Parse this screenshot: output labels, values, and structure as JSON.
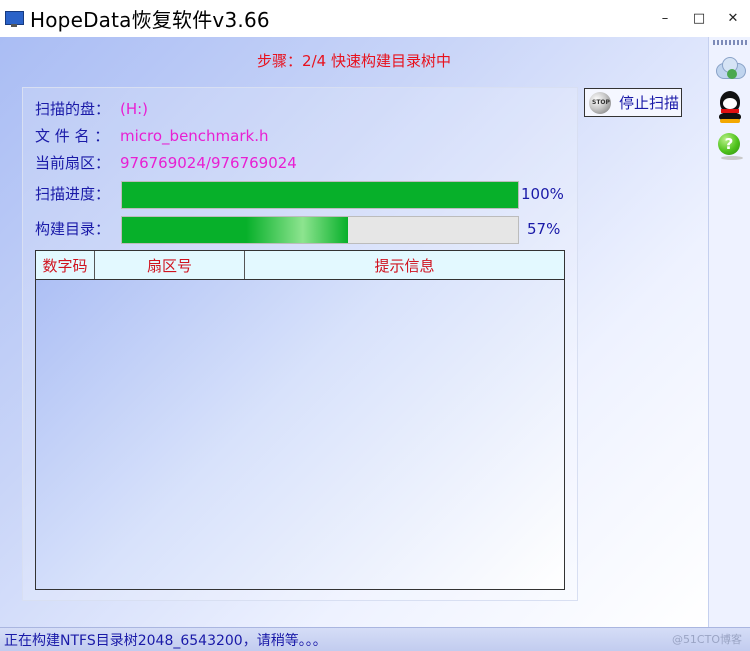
{
  "window": {
    "title": "HopeData恢复软件v3.66",
    "minimize": "–",
    "maximize": "□",
    "close": "✕"
  },
  "step_text": "步骤：2/4 快速构建目录树中",
  "info": {
    "disk_label": "扫描的盘：",
    "disk_value": "(H:)",
    "file_label": "文 件 名 ：",
    "file_value": "micro_benchmark.h",
    "sector_label": "当前扇区：",
    "sector_value": "976769024/976769024"
  },
  "progress": {
    "scan_label": "扫描进度：",
    "scan_value": 1.0,
    "scan_text": "100%",
    "build_label": "构建目录：",
    "build_value": 0.57,
    "build_text": "57%"
  },
  "table": {
    "columns": [
      "数字码",
      "扇区号",
      "提示信息"
    ],
    "rows": []
  },
  "stop_button": {
    "label": "停止扫描",
    "icon": "stop-icon",
    "icon_text": "STOP"
  },
  "sidebar": {
    "icons": [
      "cloud-icon",
      "qq-penguin-icon",
      "help-icon"
    ],
    "help_glyph": "?"
  },
  "status": {
    "text": "正在构建NTFS目录树2048_6543200，请稍等。。。",
    "watermark": "@51CTO博客"
  },
  "colors": {
    "step": "#e8111d",
    "label": "#1a1aa8",
    "value": "#e81fd2",
    "progress_fill": "#07b02a",
    "table_header_bg": "#e3f9ff",
    "table_header_text": "#d01420"
  }
}
